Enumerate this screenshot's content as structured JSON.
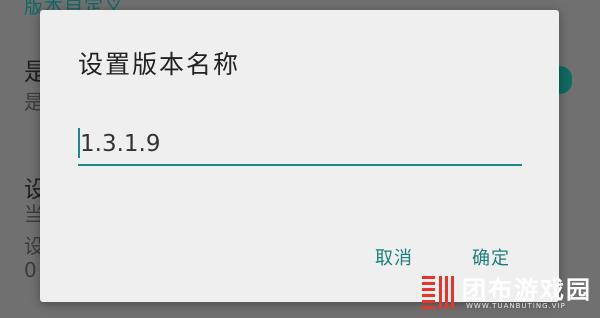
{
  "background": {
    "section_title": "版本自定义",
    "row1_title": "是",
    "row1_sub": "是",
    "row2_title": "设",
    "row2_sub1": "当",
    "row2_sub2": "设",
    "row2_sub3": "0"
  },
  "dialog": {
    "title": "设置版本名称",
    "input_value": "1.3.1.9",
    "cancel_label": "取消",
    "ok_label": "确定"
  },
  "watermark": {
    "name": "团布游戏园",
    "url": "WWW.TUANBUTING.VIP"
  },
  "colors": {
    "accent": "#1a8c86",
    "dialog_bg": "#efefef",
    "scrim": "#707070"
  }
}
